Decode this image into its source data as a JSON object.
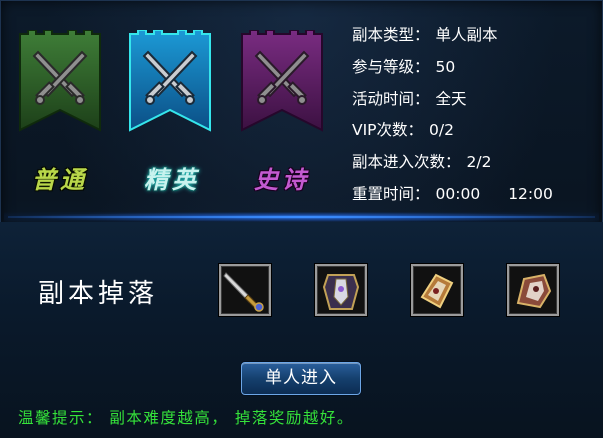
{
  "difficulties": [
    {
      "label": "普通",
      "icon": "crossed-swords-icon",
      "color": "#3e7d3a"
    },
    {
      "label": "精英",
      "icon": "crossed-swords-icon",
      "color": "#1d8fc8"
    },
    {
      "label": "史诗",
      "icon": "crossed-swords-icon",
      "color": "#7e2c86"
    }
  ],
  "info": {
    "type_label": "副本类型：",
    "type_value": "单人副本",
    "level_label": "参与等级：",
    "level_value": "50",
    "time_label": "活动时间：",
    "time_value": "全天",
    "vip_label": "VIP次数：",
    "vip_value": "0/2",
    "entries_label": "副本进入次数：",
    "entries_value": "2/2",
    "reset_label": "重置时间：",
    "reset_value_1": "00:00",
    "reset_value_2": "12:00"
  },
  "drops": {
    "title": "副本掉落",
    "items": [
      {
        "icon": "sword-item-icon"
      },
      {
        "icon": "armor-item-icon"
      },
      {
        "icon": "bracer-item-icon"
      },
      {
        "icon": "shoulder-guard-item-icon"
      }
    ]
  },
  "enter_button": "单人进入",
  "tip": "温馨提示： 副本难度越高， 掉落奖励越好。",
  "colors": {
    "accent_blue": "#3a8cff",
    "tip_green": "#35e23a"
  }
}
